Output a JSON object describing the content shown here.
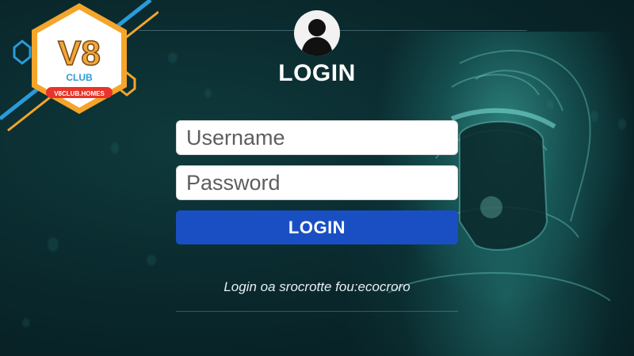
{
  "logo": {
    "brand": "V8",
    "sub": "CLUB",
    "url": "V8CLUB.HOMES"
  },
  "login": {
    "title": "LOGIN",
    "username_placeholder": "Username",
    "password_placeholder": "Password",
    "button_label": "LOGIN",
    "hint": "Login oa srocrotte fou:ecocroro"
  },
  "colors": {
    "accent": "#1a4fc4",
    "background": "#0a2a2e",
    "logo_orange": "#f4a52a",
    "logo_blue": "#2a9bd8"
  },
  "icons": {
    "avatar": "user-silhouette-icon"
  }
}
